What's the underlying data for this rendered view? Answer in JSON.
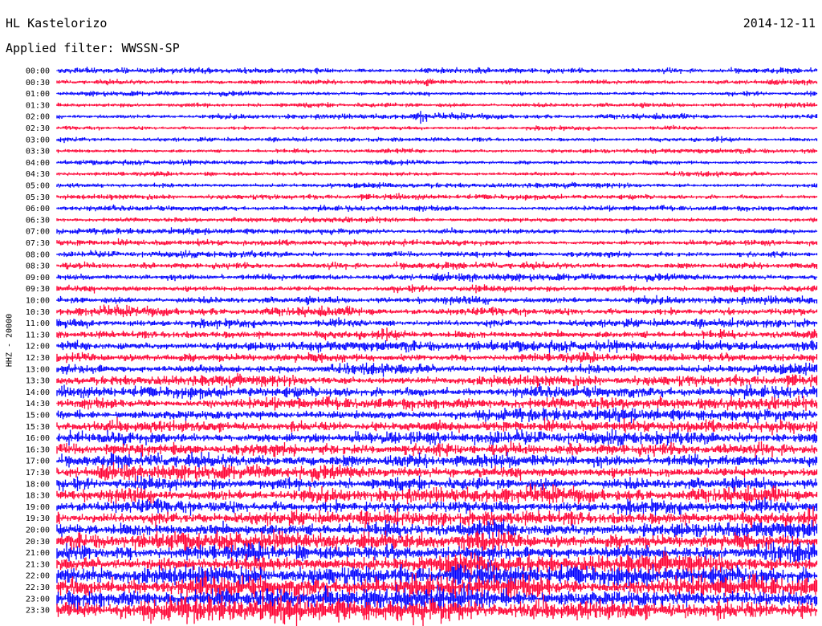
{
  "header": {
    "station": "HL Kastelorizo",
    "date": "2014-12-11",
    "filter": "Applied filter: WWSSN-SP"
  },
  "chart_data": {
    "type": "line",
    "title": "HL Kastelorizo",
    "date": "2014-12-11",
    "filter": "WWSSN-SP",
    "ylabel": "HHZ - 20000",
    "row_labels": [
      "00:00",
      "00:30",
      "01:00",
      "01:30",
      "02:00",
      "02:30",
      "03:00",
      "03:30",
      "04:00",
      "04:30",
      "05:00",
      "05:30",
      "06:00",
      "06:30",
      "07:00",
      "07:30",
      "08:00",
      "08:30",
      "09:00",
      "09:30",
      "10:00",
      "10:30",
      "11:00",
      "11:30",
      "12:00",
      "12:30",
      "13:00",
      "13:30",
      "14:00",
      "14:30",
      "15:00",
      "15:30",
      "16:00",
      "16:30",
      "17:00",
      "17:30",
      "18:00",
      "18:30",
      "19:00",
      "19:30",
      "20:00",
      "20:30",
      "21:00",
      "21:30",
      "22:00",
      "22:30",
      "23:00",
      "23:30"
    ],
    "series_colors": [
      "#0000ff",
      "#ff0033"
    ],
    "relative_amplitude": [
      0.55,
      0.5,
      0.5,
      0.55,
      0.55,
      0.5,
      0.5,
      0.5,
      0.5,
      0.5,
      0.55,
      0.55,
      0.55,
      0.55,
      0.6,
      0.6,
      0.65,
      0.7,
      0.75,
      0.8,
      0.9,
      1.0,
      1.05,
      1.1,
      1.15,
      1.2,
      1.2,
      1.25,
      1.3,
      1.3,
      1.35,
      1.4,
      1.45,
      1.5,
      1.55,
      1.6,
      1.65,
      1.7,
      1.8,
      1.9,
      2.0,
      2.1,
      2.2,
      2.3,
      2.4,
      2.5,
      2.6,
      2.7
    ],
    "events": [
      {
        "row": "02:00",
        "x_fraction": 0.48,
        "relative_amplitude": 3.2
      },
      {
        "row": "00:30",
        "x_fraction": 0.49,
        "relative_amplitude": 2.0
      }
    ]
  }
}
